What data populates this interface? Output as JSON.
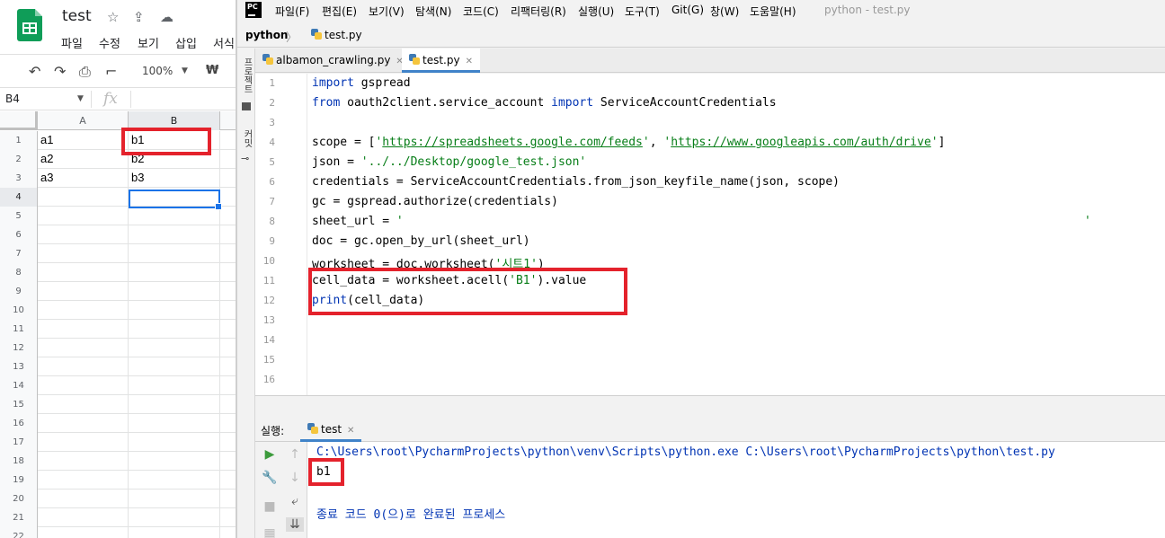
{
  "sheets": {
    "doc_title": "test",
    "menu": [
      "파일",
      "수정",
      "보기",
      "삽입",
      "서식"
    ],
    "toolbar": {
      "zoom": "100%",
      "currency": "₩"
    },
    "name_box": "B4",
    "fx": "fx",
    "columns": [
      "A",
      "B"
    ],
    "rows": [
      {
        "n": "1",
        "a": "a1",
        "b": "b1"
      },
      {
        "n": "2",
        "a": "a2",
        "b": "b2"
      },
      {
        "n": "3",
        "a": "a3",
        "b": "b3"
      },
      {
        "n": "4",
        "a": "",
        "b": ""
      },
      {
        "n": "5",
        "a": "",
        "b": ""
      },
      {
        "n": "6",
        "a": "",
        "b": ""
      },
      {
        "n": "7",
        "a": "",
        "b": ""
      },
      {
        "n": "8",
        "a": "",
        "b": ""
      },
      {
        "n": "9",
        "a": "",
        "b": ""
      },
      {
        "n": "10",
        "a": "",
        "b": ""
      },
      {
        "n": "11",
        "a": "",
        "b": ""
      },
      {
        "n": "12",
        "a": "",
        "b": ""
      },
      {
        "n": "13",
        "a": "",
        "b": ""
      },
      {
        "n": "14",
        "a": "",
        "b": ""
      },
      {
        "n": "15",
        "a": "",
        "b": ""
      },
      {
        "n": "16",
        "a": "",
        "b": ""
      },
      {
        "n": "17",
        "a": "",
        "b": ""
      },
      {
        "n": "18",
        "a": "",
        "b": ""
      },
      {
        "n": "19",
        "a": "",
        "b": ""
      },
      {
        "n": "20",
        "a": "",
        "b": ""
      },
      {
        "n": "21",
        "a": "",
        "b": ""
      },
      {
        "n": "22",
        "a": "",
        "b": ""
      }
    ]
  },
  "pycharm": {
    "logo": "PC",
    "menu": [
      "파일(F)",
      "편집(E)",
      "보기(V)",
      "탐색(N)",
      "코드(C)",
      "리팩터링(R)",
      "실행(U)",
      "도구(T)",
      "Git(G)",
      "창(W)",
      "도움말(H)"
    ],
    "window_title": "python - test.py",
    "nav": {
      "project": "python",
      "file": "test.py"
    },
    "side_labels": [
      "프로젝트",
      "커밋"
    ],
    "tabs": [
      {
        "label": "albamon_crawling.py"
      },
      {
        "label": "test.py"
      }
    ],
    "code": {
      "l1_kw": "import",
      "l1_rest": " gspread",
      "l2_kw1": "from",
      "l2_mid": " oauth2client.service_account ",
      "l2_kw2": "import",
      "l2_rest": " ServiceAccountCredentials",
      "l4_a": "scope = [",
      "l4_q1": "'",
      "l4_url1": "https://spreadsheets.google.com/feeds",
      "l4_q2": "'",
      "l4_comma": ", ",
      "l4_q3": "'",
      "l4_url2": "https://www.googleapis.com/auth/drive",
      "l4_q4": "'",
      "l4_end": "]",
      "l5_a": "json = ",
      "l5_str": "'../../Desktop/google_test.json'",
      "l6": "credentials = ServiceAccountCredentials.from_json_keyfile_name(json, scope)",
      "l7": "gc = gspread.authorize(credentials)",
      "l8_a": "sheet_url = ",
      "l8_str": "'",
      "l8_str_end": "'",
      "l9": "doc = gc.open_by_url(sheet_url)",
      "l10_a": "worksheet = doc.worksheet(",
      "l10_str": "'시트1'",
      "l10_end": ")",
      "l11_a": "cell_data = worksheet.acell(",
      "l11_str": "'B1'",
      "l11_end": ").value",
      "l12_kw": "print",
      "l12_rest": "(cell_data)"
    },
    "line_numbers": [
      "1",
      "2",
      "3",
      "4",
      "5",
      "6",
      "7",
      "8",
      "9",
      "10",
      "11",
      "12",
      "13",
      "14",
      "15",
      "16"
    ],
    "run": {
      "label": "실행:",
      "tab": "test",
      "command": "C:\\Users\\root\\PycharmProjects\\python\\venv\\Scripts\\python.exe C:\\Users\\root\\PycharmProjects\\python\\test.py",
      "output": "b1",
      "exit": "종료 코드 0(으)로 완료된 프로세스"
    },
    "colors": {
      "keyword": "#0033b3",
      "string": "#067d17",
      "highlight": "#e4222c",
      "tab_accent": "#4083c9"
    }
  }
}
